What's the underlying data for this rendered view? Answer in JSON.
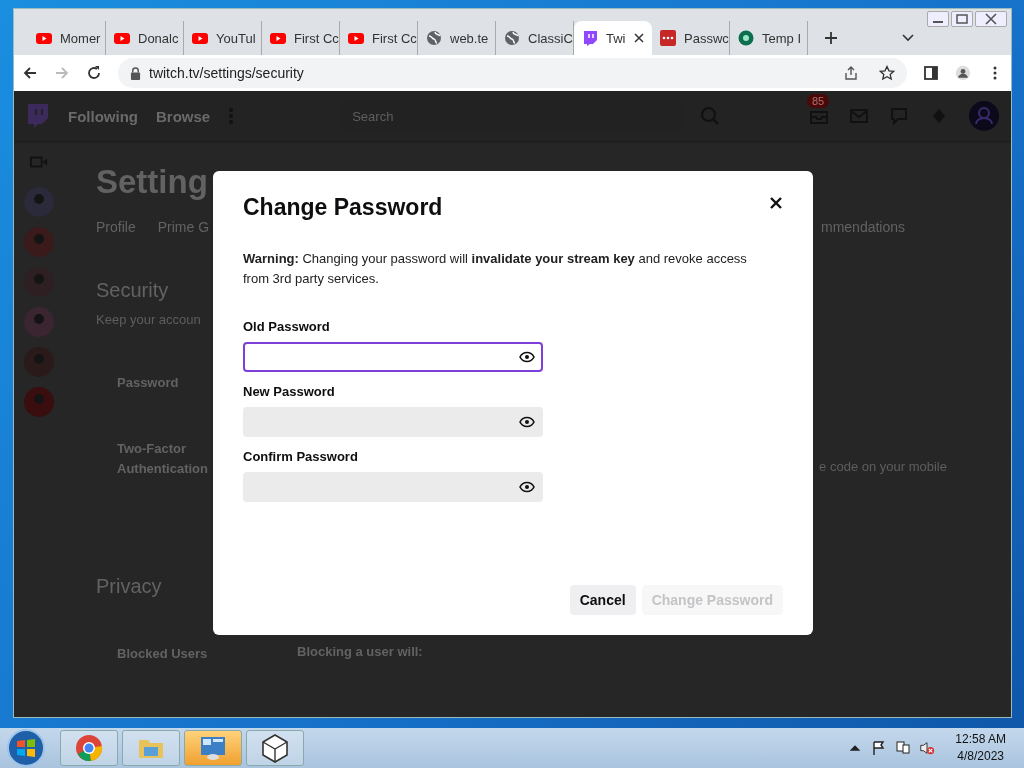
{
  "browser": {
    "tabs": [
      {
        "title": "Momer",
        "kind": "youtube",
        "selected": false
      },
      {
        "title": "Donalc",
        "kind": "youtube",
        "selected": false
      },
      {
        "title": "YouTul",
        "kind": "youtube",
        "selected": false
      },
      {
        "title": "First Cc",
        "kind": "youtube",
        "selected": false
      },
      {
        "title": "First Cc",
        "kind": "youtube",
        "selected": false
      },
      {
        "title": "web.te",
        "kind": "globe",
        "selected": false
      },
      {
        "title": "ClassiC",
        "kind": "globe",
        "selected": false
      },
      {
        "title": "Twi",
        "kind": "twitch",
        "selected": true
      },
      {
        "title": "Passwc",
        "kind": "dots",
        "selected": false
      },
      {
        "title": "Temp I",
        "kind": "tm",
        "selected": false
      }
    ],
    "address": "twitch.tv/settings/security"
  },
  "site": {
    "nav": [
      "Following",
      "Browse"
    ],
    "search_placeholder": "Search",
    "badge": "85",
    "page_title": "Setting",
    "page_tabs": [
      "Profile",
      "Prime G"
    ],
    "page_tabs_right": "mmendations",
    "section": "Security",
    "section_sub": "Keep your accoun",
    "rows": [
      {
        "label": "Password"
      },
      {
        "label": "Two-Factor Authentication",
        "aside": "e code on your mobile"
      }
    ],
    "privacy": "Privacy",
    "blocked": {
      "label": "Blocked Users",
      "heading": "Blocking a user will:"
    }
  },
  "dialog": {
    "title": "Change Password",
    "warning": "**Warning:** Changing your password will **invalidate your stream key** and revoke access from 3rd party services.",
    "fields": [
      {
        "label": "Old Password",
        "focused": true
      },
      {
        "label": "New Password",
        "focused": false
      },
      {
        "label": "Confirm Password",
        "focused": false
      }
    ],
    "buttons": [
      {
        "label": "Cancel",
        "disabled": false
      },
      {
        "label": "Change Password",
        "disabled": true
      }
    ]
  },
  "taskbar": {
    "apps": [
      {
        "kind": "chrome",
        "active": false
      },
      {
        "kind": "folder",
        "active": false
      },
      {
        "kind": "panel",
        "active": true
      },
      {
        "kind": "cube",
        "active": false
      }
    ],
    "time": "12:58 AM",
    "date": "4/8/2023"
  }
}
